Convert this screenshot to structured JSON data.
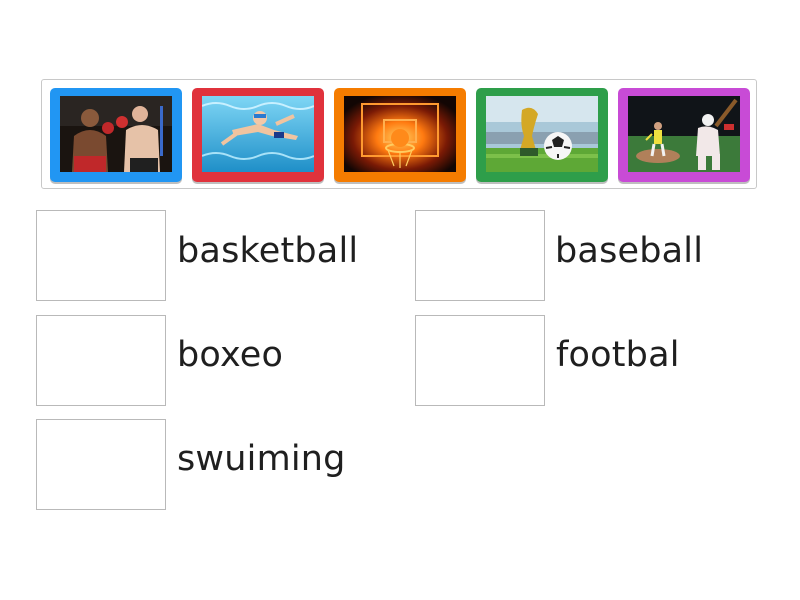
{
  "tray": {
    "cards": [
      {
        "sport_icon": "boxing-photo",
        "frame_color": "#2196f3"
      },
      {
        "sport_icon": "swimming-photo",
        "frame_color": "#e0323c"
      },
      {
        "sport_icon": "basketball-photo",
        "frame_color": "#f57c00"
      },
      {
        "sport_icon": "soccer-photo",
        "frame_color": "#2e9e4a"
      },
      {
        "sport_icon": "baseball-photo",
        "frame_color": "#c84bd6"
      }
    ]
  },
  "targets": [
    {
      "label": "basketball"
    },
    {
      "label": "baseball"
    },
    {
      "label": "boxeo"
    },
    {
      "label": "footbal"
    },
    {
      "label": "swuiming"
    }
  ]
}
